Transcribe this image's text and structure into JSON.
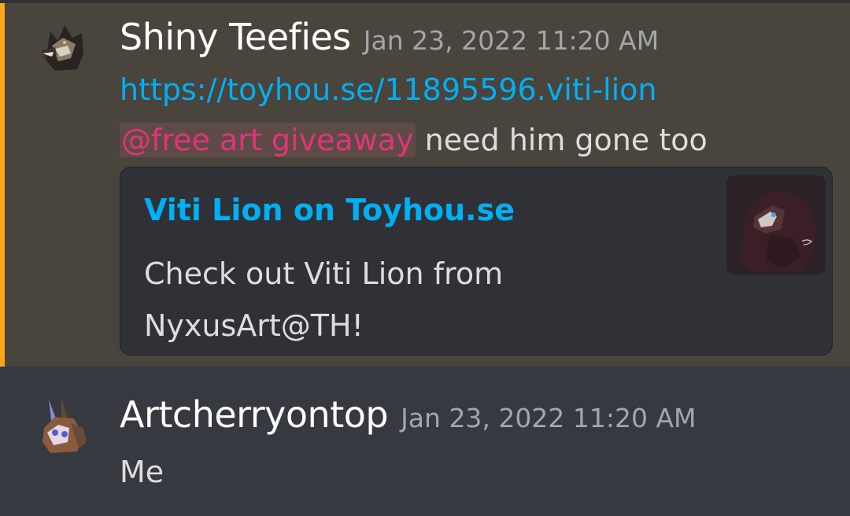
{
  "messages": [
    {
      "username": "Shiny Teefies",
      "timestamp": "Jan 23, 2022 11:20 AM",
      "link": "https://toyhou.se/11895596.viti-lion",
      "mention": "@free art giveaway",
      "text": " need him gone too",
      "embed": {
        "title": "Viti Lion on Toyhou.se",
        "description": "Check out Viti Lion from NyxusArt@TH!"
      },
      "highlight_color": "#faa81a"
    },
    {
      "username": "Artcherryontop",
      "timestamp": "Jan 23, 2022 11:20 AM",
      "text": "Me"
    }
  ],
  "icons": {
    "avatar_1": "wolf-avatar-icon",
    "avatar_2": "unicorn-avatar-icon",
    "embed_thumbnail": "lion-thumbnail-image"
  }
}
